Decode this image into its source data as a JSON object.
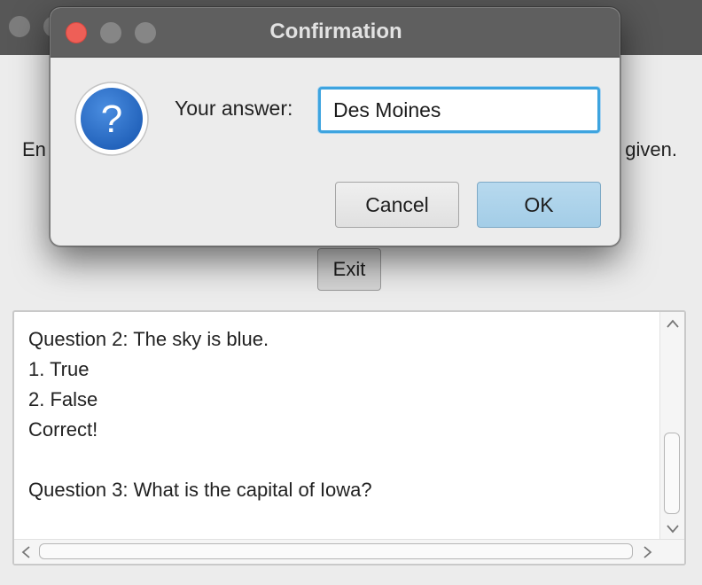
{
  "main_window": {
    "instruction_left": "En",
    "instruction_right": "given.",
    "exit_label": "Exit",
    "output_lines": [
      "Question 2: The sky is blue.",
      "1. True",
      "2. False",
      "Correct!",
      "",
      "Question 3: What is the capital of Iowa?"
    ]
  },
  "dialog": {
    "title": "Confirmation",
    "prompt_label": "Your answer:",
    "answer_value": "Des Moines",
    "cancel_label": "Cancel",
    "ok_label": "OK",
    "icon": "question-icon",
    "question_glyph": "?"
  },
  "colors": {
    "accent": "#3ea4df",
    "ok_button": "#a3cde7",
    "close_button": "#ee5f57",
    "icon_blue": "#2d6ec9"
  }
}
